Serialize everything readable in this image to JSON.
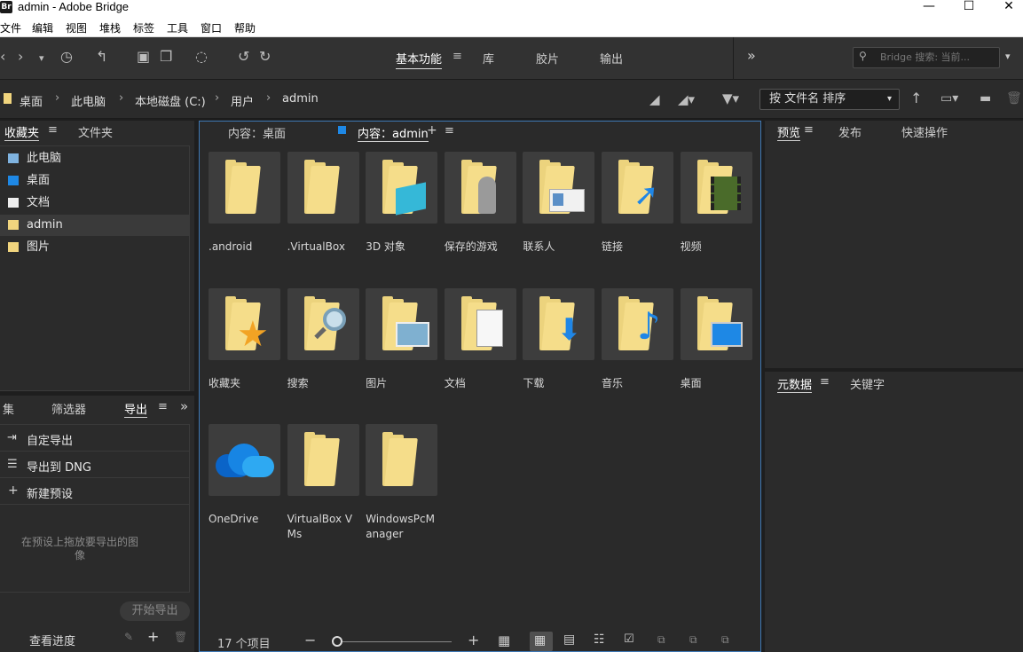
{
  "window": {
    "title": "admin - Adobe Bridge",
    "logo": "Br",
    "minimize": "—",
    "maximize": "☐",
    "close": "✕"
  },
  "menu": [
    "文件",
    "编辑",
    "视图",
    "堆栈",
    "标签",
    "工具",
    "窗口",
    "帮助"
  ],
  "toolbar": {
    "workspaces": [
      "基本功能",
      "库",
      "胶片",
      "输出"
    ],
    "more": "»",
    "search_placeholder": "Bridge 搜索: 当前..."
  },
  "path": {
    "crumbs": [
      "桌面",
      "此电脑",
      "本地磁盘 (C:)",
      "用户",
      "admin"
    ],
    "sort_label": "按 文件名 排序"
  },
  "left_top": {
    "tabs": [
      "收藏夹",
      "文件夹"
    ],
    "favorites": [
      "此电脑",
      "桌面",
      "文档",
      "admin",
      "图片"
    ]
  },
  "left_bottom": {
    "tabs": [
      "集",
      "筛选器",
      "导出"
    ],
    "items": [
      "自定导出",
      "导出到 DNG",
      "新建预设"
    ],
    "drop_hint": "在预设上拖放要导出的图像",
    "export_button": "开始导出",
    "progress": "查看进度"
  },
  "content": {
    "tabs": [
      "内容：桌面",
      "内容：admin"
    ],
    "items": [
      {
        "name": ".android",
        "icon": "folder-icon"
      },
      {
        "name": ".VirtualBox",
        "icon": "folder-icon"
      },
      {
        "name": "3D 对象",
        "icon": "3d-objects-folder-icon"
      },
      {
        "name": "保存的游戏",
        "icon": "saved-games-folder-icon"
      },
      {
        "name": "联系人",
        "icon": "contacts-folder-icon"
      },
      {
        "name": "链接",
        "icon": "links-folder-icon"
      },
      {
        "name": "视频",
        "icon": "videos-folder-icon"
      },
      {
        "name": "收藏夹",
        "icon": "favorites-folder-icon"
      },
      {
        "name": "搜索",
        "icon": "searches-folder-icon"
      },
      {
        "name": "图片",
        "icon": "pictures-folder-icon"
      },
      {
        "name": "文档",
        "icon": "documents-folder-icon"
      },
      {
        "name": "下载",
        "icon": "downloads-folder-icon"
      },
      {
        "name": "音乐",
        "icon": "music-folder-icon"
      },
      {
        "name": "桌面",
        "icon": "desktop-folder-icon"
      },
      {
        "name": "OneDrive",
        "icon": "onedrive-icon"
      },
      {
        "name": "VirtualBox VMs",
        "icon": "folder-icon"
      },
      {
        "name": "WindowsPcManager",
        "icon": "folder-icon"
      }
    ],
    "item_count": "17 个项目"
  },
  "right": {
    "top_tabs": [
      "预览",
      "发布",
      "快速操作"
    ],
    "bottom_tabs": [
      "元数据",
      "关键字"
    ]
  },
  "colors": {
    "accent": "#3e78b5",
    "folder": "#f5dd8a",
    "panel": "#2b2b2b"
  }
}
